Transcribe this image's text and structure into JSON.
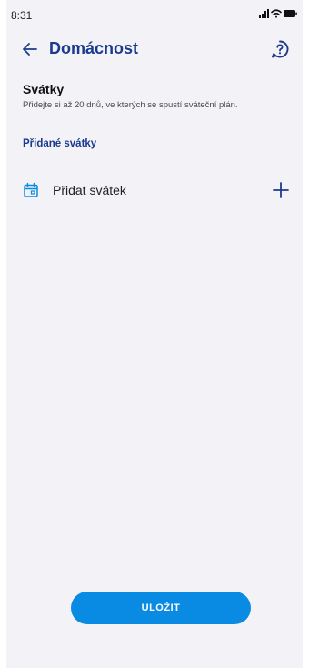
{
  "status_bar": {
    "time": "8:31"
  },
  "header": {
    "title": "Domácnost",
    "back_icon": "arrow-left-icon",
    "help_icon": "help-circle-icon"
  },
  "section": {
    "title": "Svátky",
    "description": "Přidejte si až 20 dnů, ve kterých se spustí sváteční plán."
  },
  "added": {
    "title": "Přidané svátky"
  },
  "add_row": {
    "label": "Přidat svátek",
    "icon": "calendar-icon",
    "action_icon": "plus-icon"
  },
  "actions": {
    "save_label": "ULOŽIT"
  },
  "colors": {
    "accent": "#1b3a8f",
    "button": "#0a8be3",
    "background": "#f3f3f7"
  }
}
